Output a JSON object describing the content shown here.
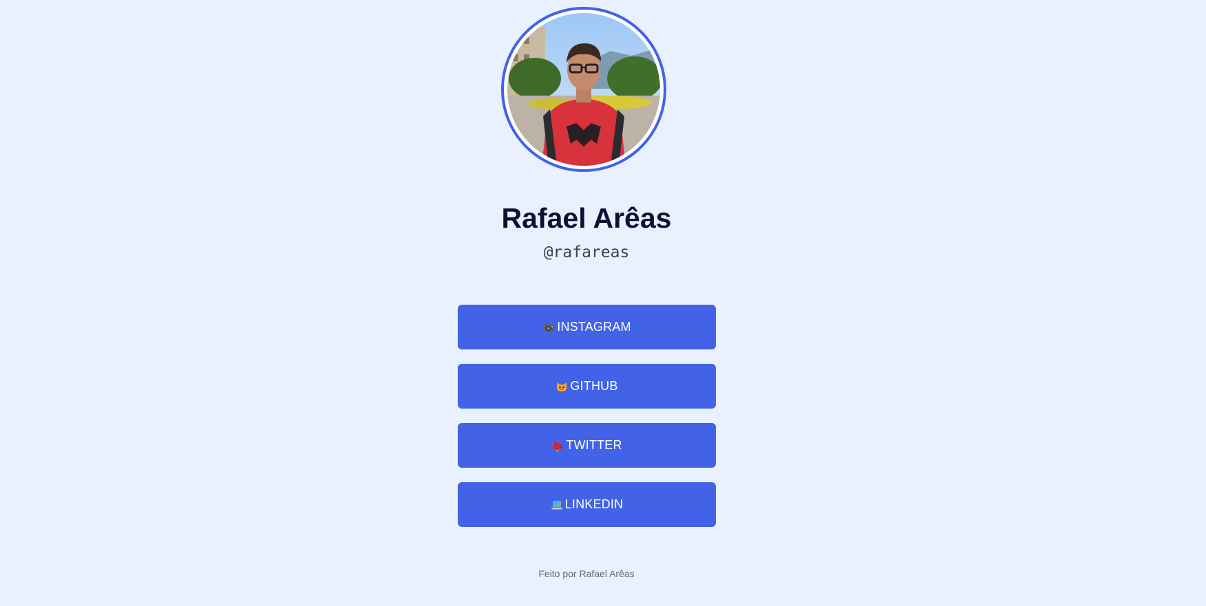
{
  "profile": {
    "name": "Rafael Arêas",
    "handle": "@rafareas"
  },
  "links": [
    {
      "label": "INSTAGRAM",
      "icon": "camera-icon"
    },
    {
      "label": "GITHUB",
      "icon": "cat-icon"
    },
    {
      "label": "TWITTER",
      "icon": "bird-icon"
    },
    {
      "label": "LINKEDIN",
      "icon": "laptop-icon"
    }
  ],
  "footer": {
    "text": "Feito por Rafael Arêas"
  },
  "colors": {
    "background": "#eaf1fe",
    "accent": "#4262e7",
    "title": "#0c1233",
    "footer": "#5e6577"
  }
}
